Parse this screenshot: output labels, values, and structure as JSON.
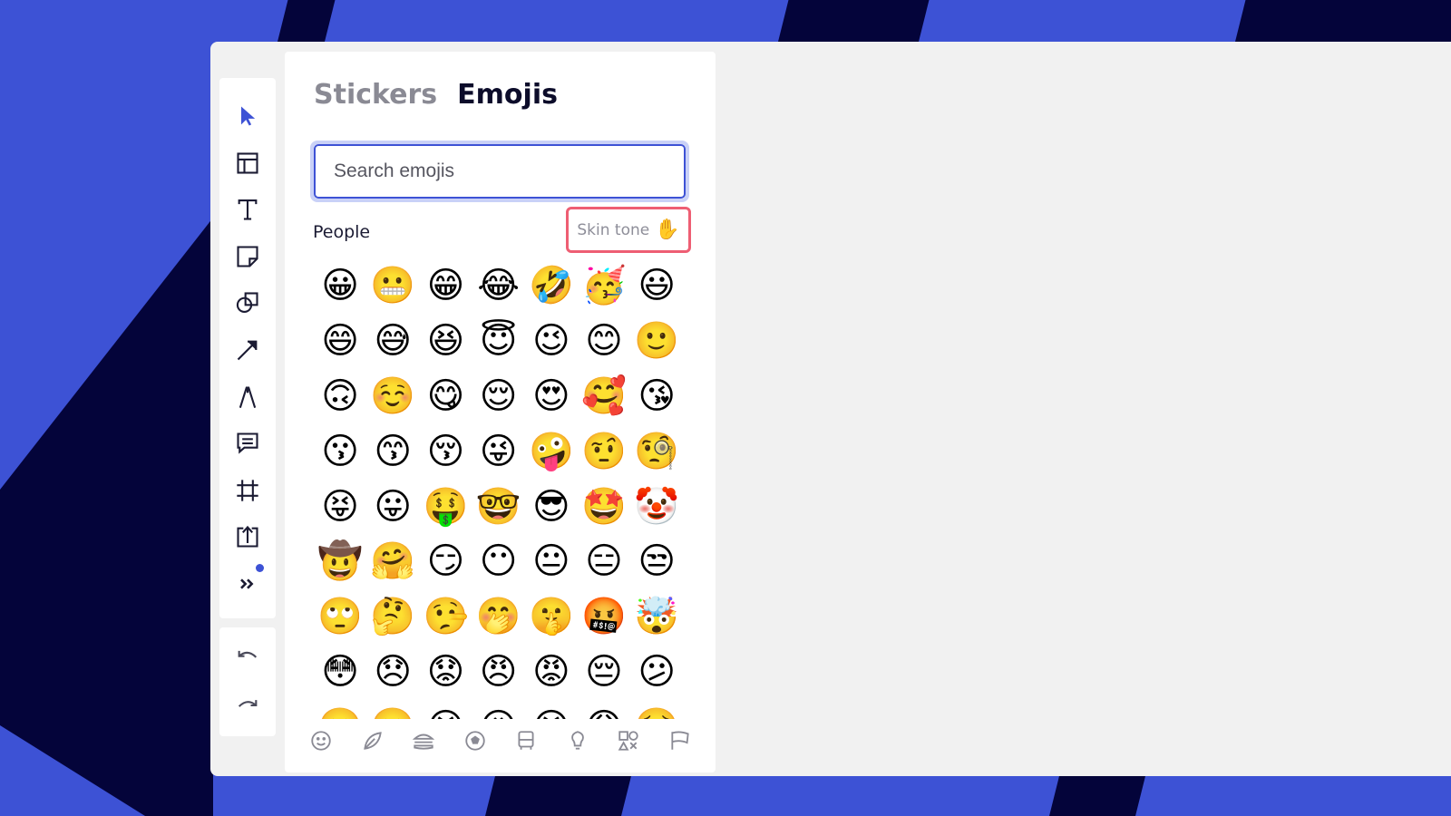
{
  "panel": {
    "tabs": [
      {
        "label": "Stickers",
        "active": false
      },
      {
        "label": "Emojis",
        "active": true
      }
    ],
    "search": {
      "placeholder": "Search emojis",
      "value": ""
    },
    "section_label": "People",
    "skin_tone": {
      "label": "Skin tone",
      "glyph": "✋"
    },
    "emojis": [
      "😀",
      "😬",
      "😁",
      "😂",
      "🤣",
      "🥳",
      "😃",
      "😄",
      "😅",
      "😆",
      "😇",
      "😉",
      "😊",
      "🙂",
      "🙃",
      "☺️",
      "😋",
      "😌",
      "😍",
      "🥰",
      "😘",
      "😗",
      "😙",
      "😚",
      "😜",
      "🤪",
      "🤨",
      "🧐",
      "😝",
      "😛",
      "🤑",
      "🤓",
      "😎",
      "🤩",
      "🤡",
      "🤠",
      "🤗",
      "😏",
      "😶",
      "😐",
      "😑",
      "😒",
      "🙄",
      "🤔",
      "🤥",
      "🤭",
      "🤫",
      "🤬",
      "🤯",
      "😳",
      "😞",
      "😟",
      "😠",
      "😡",
      "😔",
      "😕",
      "🙁",
      "☹️",
      "😣",
      "😖",
      "😫",
      "😩",
      "🥺"
    ],
    "categories": [
      "smiley-icon",
      "leaf-icon",
      "burger-icon",
      "ball-icon",
      "bus-icon",
      "bulb-icon",
      "symbols-icon",
      "flag-icon"
    ]
  },
  "toolbar": {
    "tools": [
      "select-arrow-icon",
      "layout-icon",
      "text-icon",
      "sticky-note-icon",
      "shapes-icon",
      "arrow-line-icon",
      "pen-icon",
      "comment-icon",
      "frame-icon",
      "upload-icon",
      "more-tools-icon"
    ],
    "history": [
      "undo-icon",
      "redo-icon"
    ]
  },
  "colors": {
    "accent": "#3d52d5",
    "highlight": "#ee5e73",
    "dark": "#04043a"
  }
}
